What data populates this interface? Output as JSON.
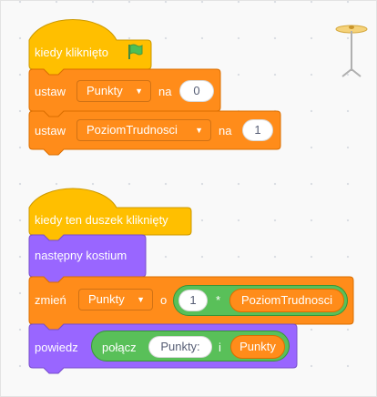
{
  "script1": {
    "hat_label": "kiedy kliknięto",
    "flag_icon": "green-flag",
    "set1": {
      "label": "ustaw",
      "variable": "Punkty",
      "word": "na",
      "value": "0"
    },
    "set2": {
      "label": "ustaw",
      "variable": "PoziomTrudnosci",
      "word": "na",
      "value": "1"
    }
  },
  "script2": {
    "hat_label": "kiedy ten duszek kliknięty",
    "next_costume": "następny kostium",
    "change": {
      "label": "zmień",
      "variable": "Punkty",
      "word": "o",
      "op_left": "1",
      "operator": "*",
      "op_right": "PoziomTrudnosci"
    },
    "say": {
      "label": "powiedz",
      "join_label": "połącz",
      "text": "Punkty:",
      "joiner": "i",
      "var": "Punkty"
    }
  },
  "colors": {
    "events": "#ffbf00",
    "variables": "#ff8c1a",
    "looks": "#9966ff",
    "operators": "#59c059"
  }
}
